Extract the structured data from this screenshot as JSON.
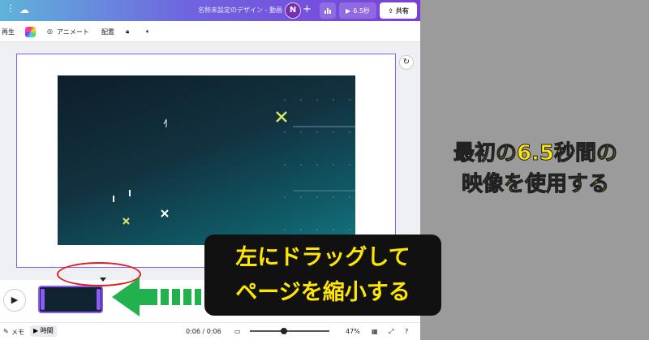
{
  "topbar": {
    "design_title": "名称未設定のデザイン - 動画",
    "avatar_initial": "N",
    "play_label": "6.5秒",
    "share_label": "共有"
  },
  "toolbar2": {
    "play_label": "再生",
    "animate_label": "アニメート",
    "position_label": "配置"
  },
  "bottombar": {
    "notes_label": "メモ",
    "time_label": "時間",
    "timecode": "0:06 / 0:06",
    "zoom": "47%"
  },
  "overlay": {
    "yellow_line1": "最初の6.5秒間の",
    "yellow_line2": "映像を使用する",
    "box_line1": "左にドラッグして",
    "box_line2": "ページを縮小する"
  },
  "colors": {
    "accent": "#8b5cf6",
    "annotation_yellow": "#ffe600",
    "arrow_green": "#22b14c",
    "circle_red": "#e01e1e"
  }
}
